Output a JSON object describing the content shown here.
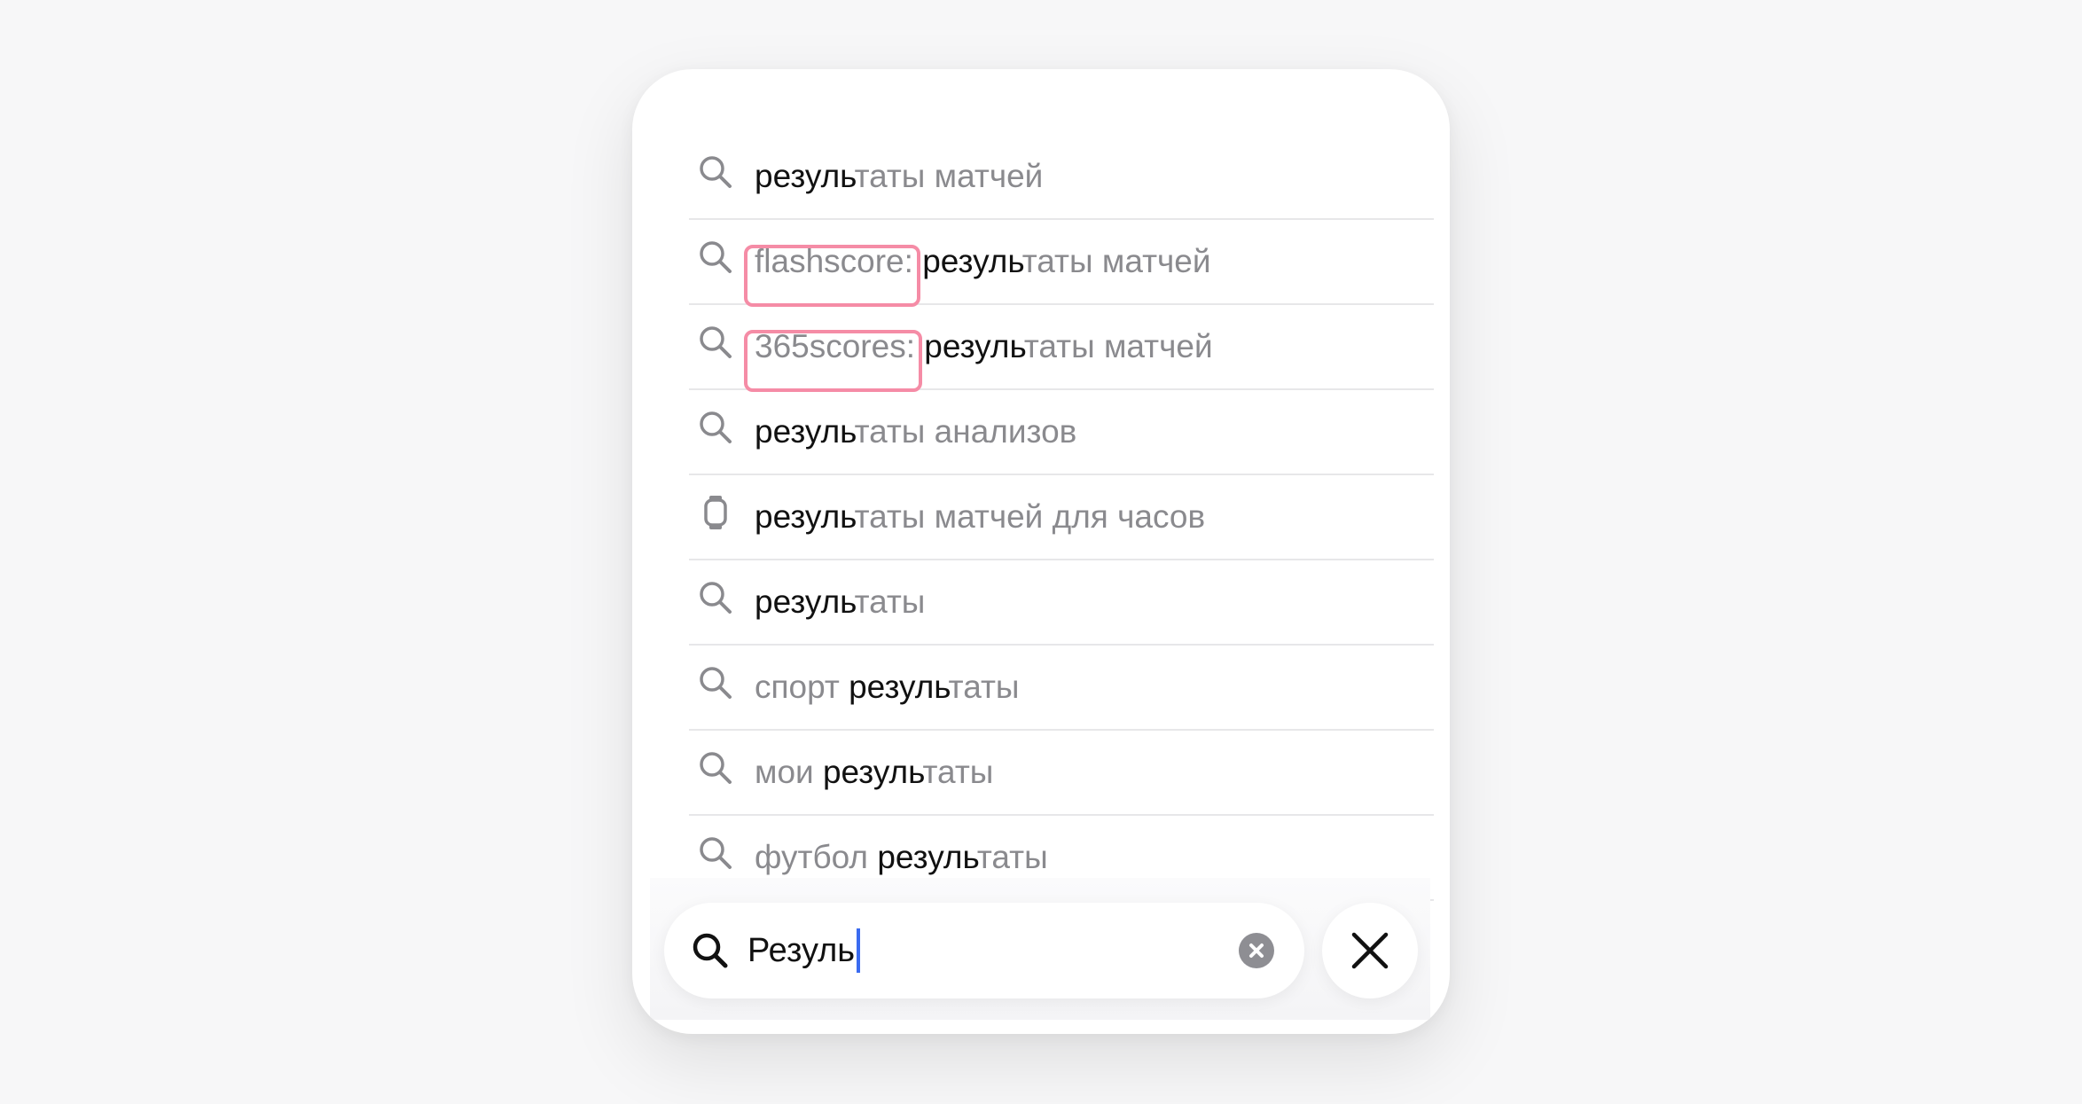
{
  "suggestions": [
    {
      "icon": "search-icon",
      "parts": [
        {
          "t": "резуль",
          "hl": true
        },
        {
          "t": "таты матчей"
        }
      ]
    },
    {
      "icon": "search-icon",
      "parts": [
        {
          "t": "flashscore:",
          "tag": true
        },
        {
          "t": " "
        },
        {
          "t": "резуль",
          "hl": true
        },
        {
          "t": "таты матчей"
        }
      ]
    },
    {
      "icon": "search-icon",
      "parts": [
        {
          "t": "365scores:",
          "tag": true
        },
        {
          "t": " "
        },
        {
          "t": "резуль",
          "hl": true
        },
        {
          "t": "таты матчей"
        }
      ]
    },
    {
      "icon": "search-icon",
      "parts": [
        {
          "t": "резуль",
          "hl": true
        },
        {
          "t": "таты анализов"
        }
      ]
    },
    {
      "icon": "watch-icon",
      "parts": [
        {
          "t": "резуль",
          "hl": true
        },
        {
          "t": "таты матчей для часов"
        }
      ]
    },
    {
      "icon": "search-icon",
      "parts": [
        {
          "t": "резуль",
          "hl": true
        },
        {
          "t": "таты"
        }
      ]
    },
    {
      "icon": "search-icon",
      "parts": [
        {
          "t": "спорт "
        },
        {
          "t": "резуль",
          "hl": true
        },
        {
          "t": "таты"
        }
      ]
    },
    {
      "icon": "search-icon",
      "parts": [
        {
          "t": "мои "
        },
        {
          "t": "резуль",
          "hl": true
        },
        {
          "t": "таты"
        }
      ]
    },
    {
      "icon": "search-icon",
      "parts": [
        {
          "t": "футбол "
        },
        {
          "t": "резуль",
          "hl": true
        },
        {
          "t": "таты"
        }
      ]
    }
  ],
  "search": {
    "query": "Резуль",
    "clear_icon": "clear-circle-icon",
    "close_icon": "close-icon"
  },
  "colors": {
    "highlight_text": "#111111",
    "muted_text": "#8a8a8e",
    "annotation_border": "#f58ca6",
    "caret": "#3a6bf0"
  }
}
